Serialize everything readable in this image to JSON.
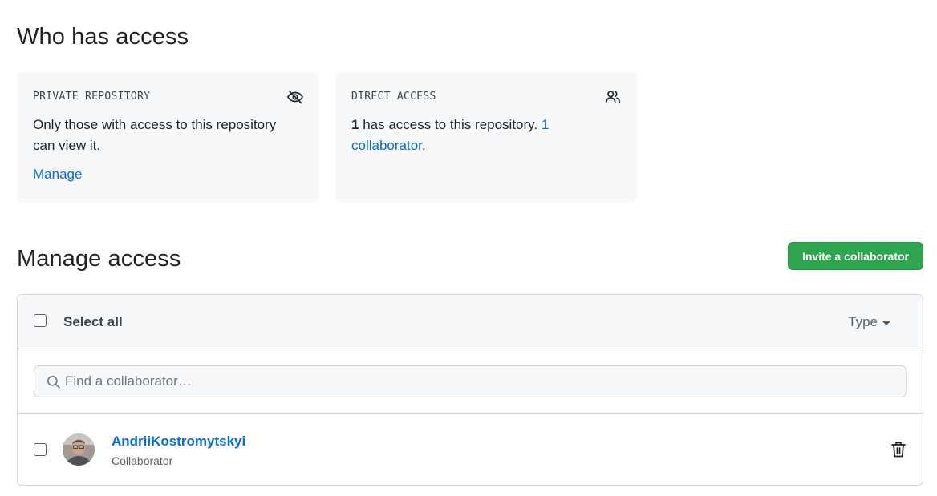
{
  "who_has_access": {
    "title": "Who has access",
    "private_card": {
      "label": "PRIVATE REPOSITORY",
      "icon": "eye-closed-icon",
      "text": "Only those with access to this repository can view it.",
      "link": "Manage"
    },
    "direct_card": {
      "label": "DIRECT ACCESS",
      "icon": "people-icon",
      "count": "1",
      "text": " has access to this repository. ",
      "link": "1 collaborator",
      "suffix": "."
    }
  },
  "manage_access": {
    "title": "Manage access",
    "invite_button": "Invite a collaborator",
    "select_all": "Select all",
    "type_filter": "Type",
    "search_placeholder": "Find a collaborator…",
    "members": [
      {
        "name": "AndriiKostromytskyi",
        "role": "Collaborator",
        "avatar": "avatar"
      }
    ]
  },
  "colors": {
    "accent": "#0969da",
    "primary_button": "#2da44e",
    "card_bg": "#f6f8fa",
    "border": "#d0d7de"
  }
}
